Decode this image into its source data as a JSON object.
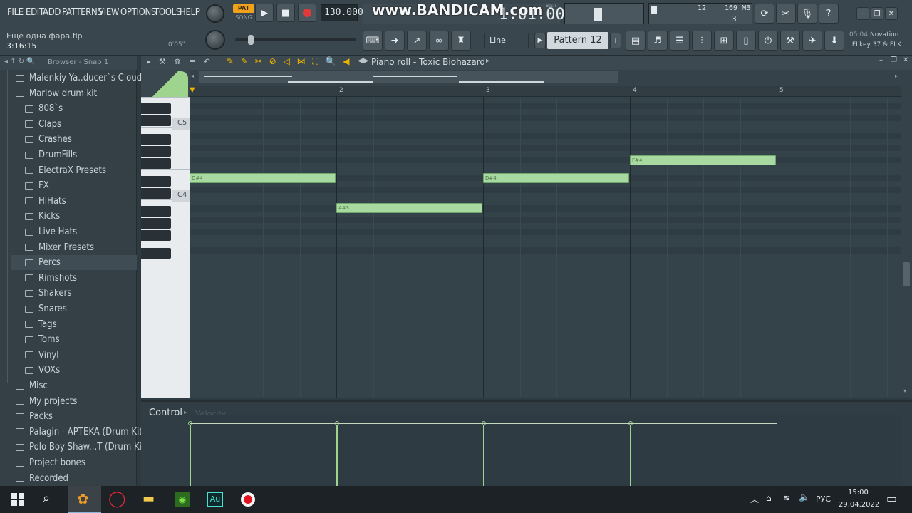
{
  "menu": [
    "FILE",
    "EDIT",
    "ADD",
    "PATTERNS",
    "VIEW",
    "OPTIONS",
    "TOOLS",
    "HELP"
  ],
  "project": {
    "file": "Ещё одна фара.flp",
    "time": "3:16:15",
    "small_time": "0'05\""
  },
  "transport": {
    "pat_label": "PAT",
    "song_label": "SONG",
    "tempo": "130.000",
    "time_display": "1:01:00",
    "bst_label": "B:S:T"
  },
  "watermark": "www.BANDICAM.com",
  "cpu": {
    "value": "12",
    "memory": "169 MB",
    "polyphony": "3"
  },
  "tools": {
    "line_mode": "Line",
    "pattern": "Pattern 12",
    "hint_time": "05:04",
    "hint_device": "Novation",
    "hint_device2": "| FLkey 37 & FLK"
  },
  "browser": {
    "title": "Browser - Snap 1",
    "items": [
      {
        "label": "Malenkiy Ya..ducer`s Cloud]",
        "level": 0
      },
      {
        "label": "Marlow drum kit",
        "level": 0
      },
      {
        "label": "808`s",
        "level": 1
      },
      {
        "label": "Claps",
        "level": 1
      },
      {
        "label": "Crashes",
        "level": 1
      },
      {
        "label": "DrumFills",
        "level": 1
      },
      {
        "label": "ElectraX Presets",
        "level": 1
      },
      {
        "label": "FX",
        "level": 1
      },
      {
        "label": "HiHats",
        "level": 1
      },
      {
        "label": "Kicks",
        "level": 1
      },
      {
        "label": "Live Hats",
        "level": 1
      },
      {
        "label": "Mixer Presets",
        "level": 1
      },
      {
        "label": "Percs",
        "level": 1
      },
      {
        "label": "Rimshots",
        "level": 1
      },
      {
        "label": "Shakers",
        "level": 1
      },
      {
        "label": "Snares",
        "level": 1
      },
      {
        "label": "Tags",
        "level": 1
      },
      {
        "label": "Toms",
        "level": 1
      },
      {
        "label": "Vinyl",
        "level": 1
      },
      {
        "label": "VOXs",
        "level": 1
      },
      {
        "label": "Misc",
        "level": 0
      },
      {
        "label": "My projects",
        "level": 0
      },
      {
        "label": "Packs",
        "level": 0
      },
      {
        "label": "Palagin - APTEKA (Drum Kit)",
        "level": 0
      },
      {
        "label": "Polo Boy Shaw...T (Drum Kit)",
        "level": 0
      },
      {
        "label": "Project bones",
        "level": 0
      },
      {
        "label": "Recorded",
        "level": 0
      }
    ]
  },
  "piano_roll": {
    "title": "Piano roll - Toxic Biohazard",
    "bars": [
      "2",
      "3",
      "4",
      "5"
    ],
    "key_labels": [
      "C5",
      "C4"
    ],
    "notes": [
      {
        "label": "D#4",
        "start": 0,
        "length": 1,
        "pitch": "D#4"
      },
      {
        "label": "A#3",
        "start": 1,
        "length": 1,
        "pitch": "A#3"
      },
      {
        "label": "D#4",
        "start": 2,
        "length": 1,
        "pitch": "D#4"
      },
      {
        "label": "F#4",
        "start": 3,
        "length": 1,
        "pitch": "F#4"
      }
    ],
    "control_label": "Control",
    "control_target": "Velocity"
  },
  "taskbar": {
    "lang": "РУС",
    "clock_time": "15:00",
    "clock_date": "29.04.2022"
  },
  "colors": {
    "note": "#a8d9a0",
    "grid": "#34424a",
    "accent_green": "#9fd48f"
  }
}
